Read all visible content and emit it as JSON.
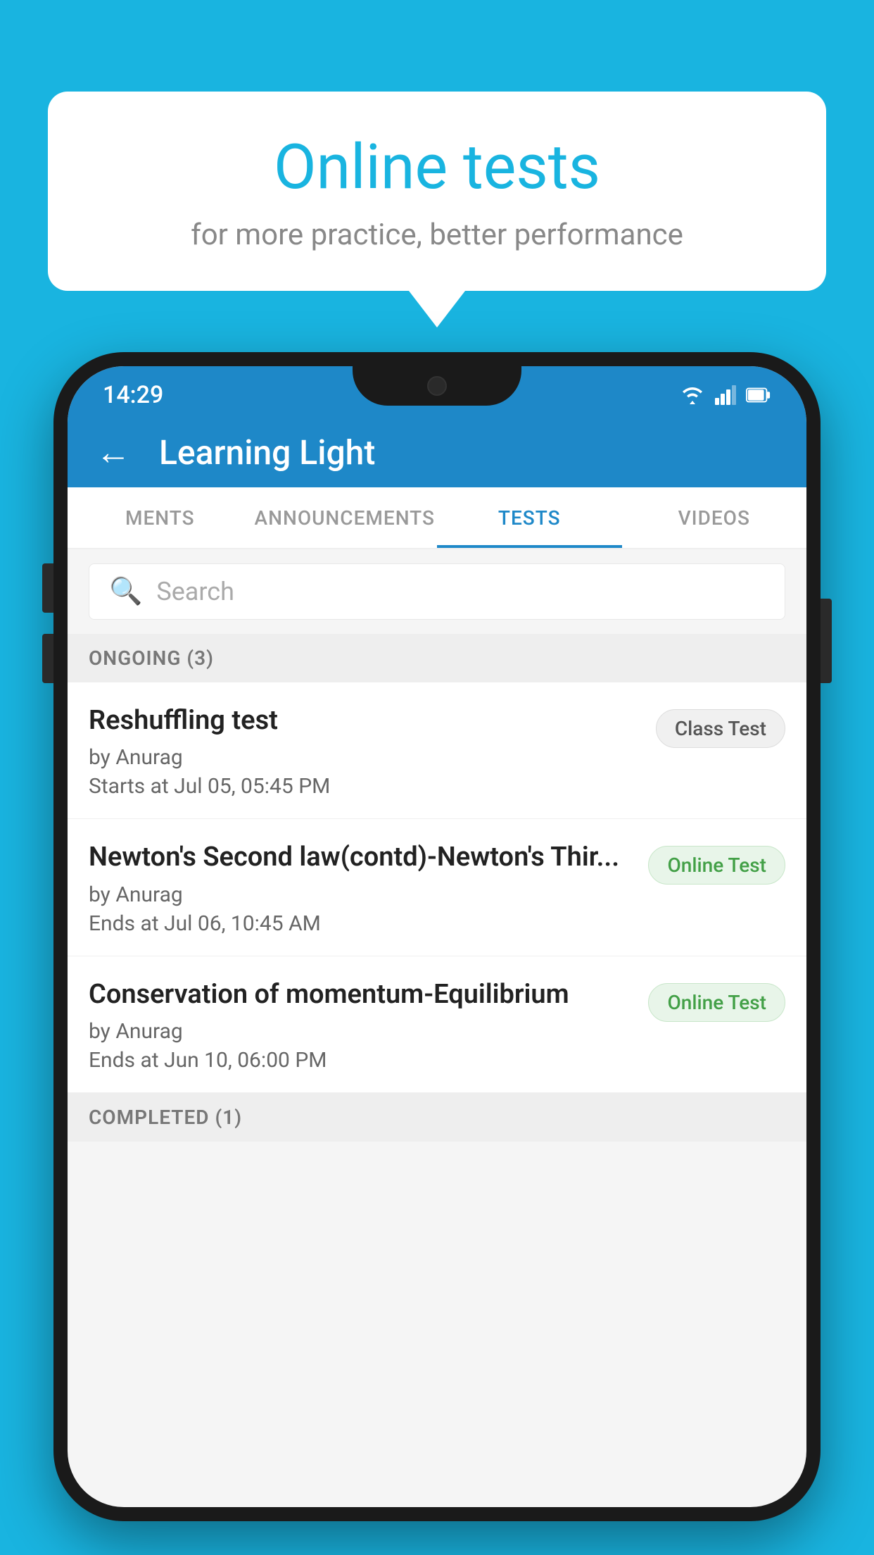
{
  "background": {
    "color": "#19b4e0"
  },
  "speech_bubble": {
    "title": "Online tests",
    "subtitle": "for more practice, better performance"
  },
  "phone": {
    "status_bar": {
      "time": "14:29",
      "wifi": "wifi",
      "signal": "signal",
      "battery": "battery"
    },
    "app_bar": {
      "back_label": "←",
      "title": "Learning Light"
    },
    "tabs": [
      {
        "label": "MENTS",
        "active": false
      },
      {
        "label": "ANNOUNCEMENTS",
        "active": false
      },
      {
        "label": "TESTS",
        "active": true
      },
      {
        "label": "VIDEOS",
        "active": false
      }
    ],
    "search": {
      "placeholder": "Search"
    },
    "ongoing_section": {
      "header": "ONGOING (3)",
      "items": [
        {
          "name": "Reshuffling test",
          "author": "by Anurag",
          "date": "Starts at  Jul 05, 05:45 PM",
          "badge": "Class Test",
          "badge_type": "class"
        },
        {
          "name": "Newton's Second law(contd)-Newton's Thir...",
          "author": "by Anurag",
          "date": "Ends at  Jul 06, 10:45 AM",
          "badge": "Online Test",
          "badge_type": "online"
        },
        {
          "name": "Conservation of momentum-Equilibrium",
          "author": "by Anurag",
          "date": "Ends at  Jun 10, 06:00 PM",
          "badge": "Online Test",
          "badge_type": "online"
        }
      ]
    },
    "completed_section": {
      "header": "COMPLETED (1)"
    }
  }
}
